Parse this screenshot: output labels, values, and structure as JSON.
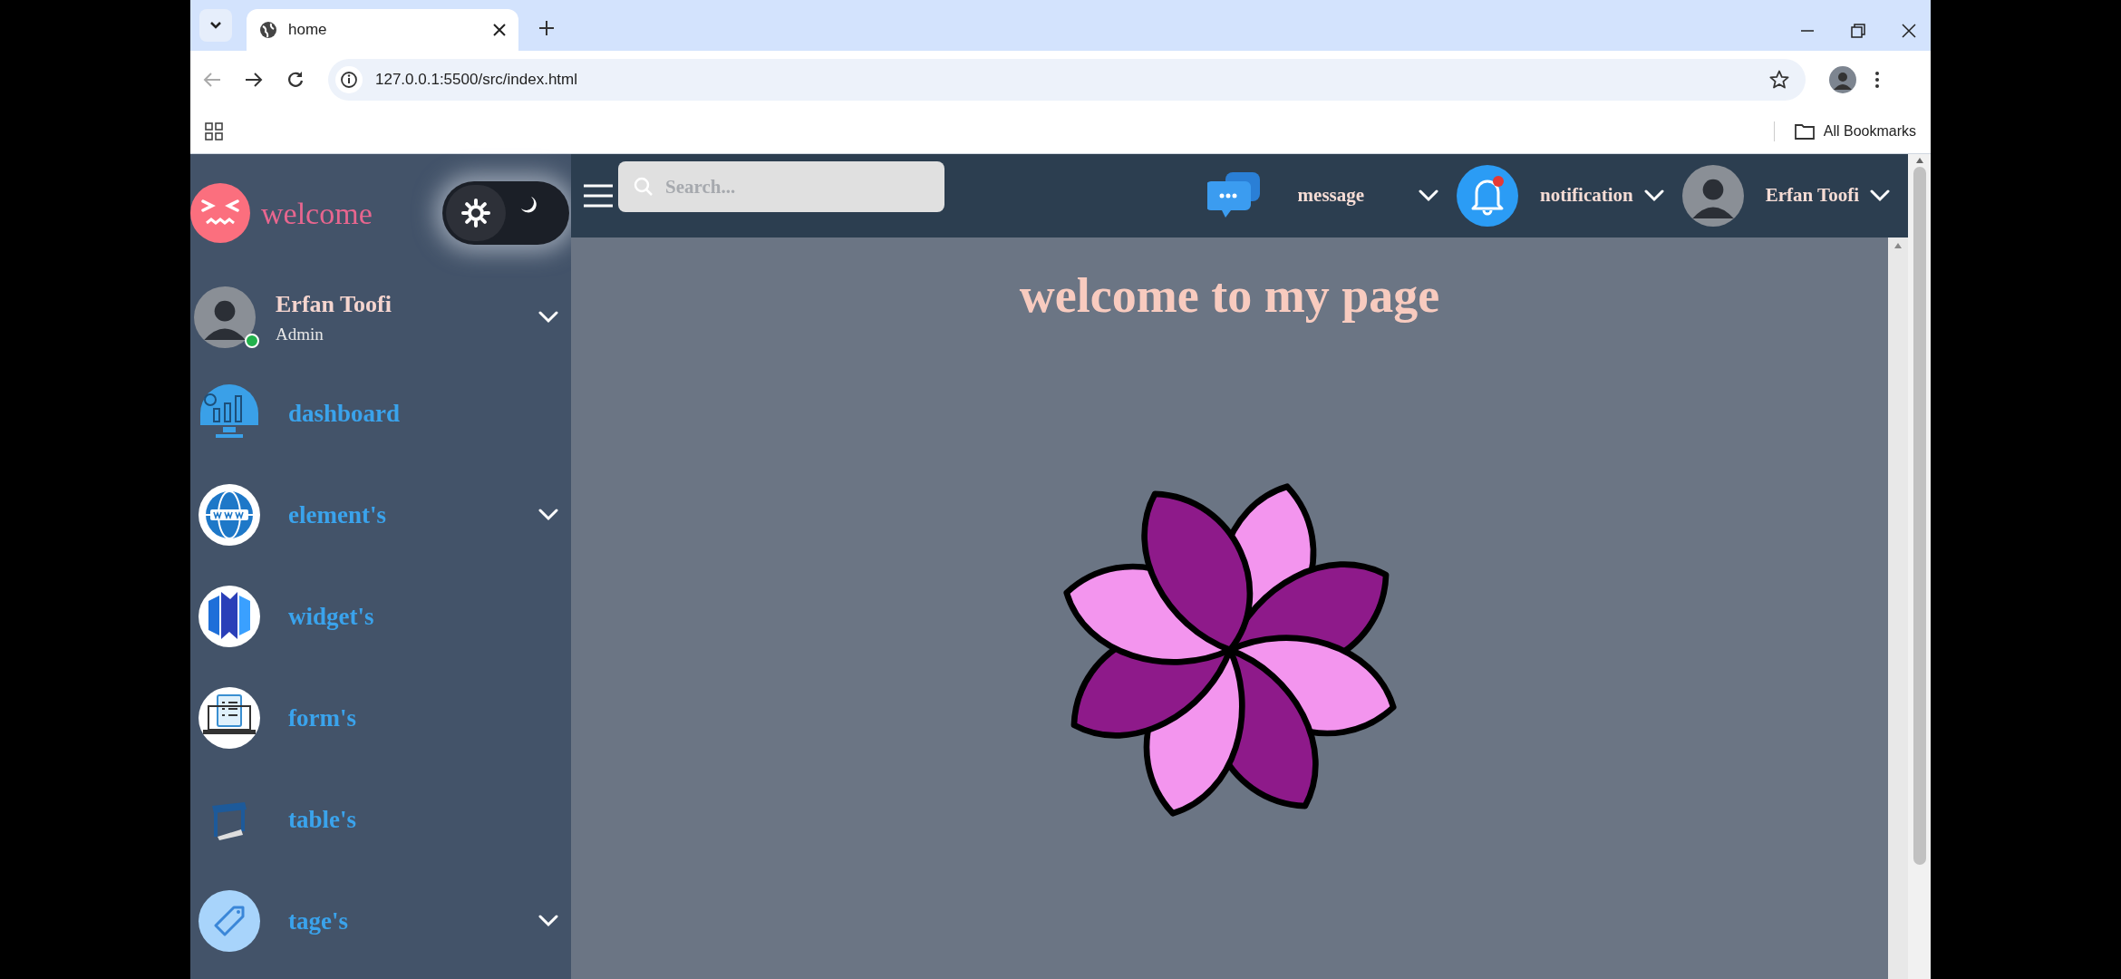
{
  "browser": {
    "tab": {
      "title": "home"
    },
    "address": "127.0.0.1:5500/src/index.html",
    "bookmarks": "All Bookmarks"
  },
  "sidebar": {
    "brand": "welcome",
    "theme_toggle": {
      "dark": true
    },
    "user": {
      "name": "Erfan Toofi",
      "role": "Admin",
      "online": true
    },
    "items": [
      {
        "label": "dashboard",
        "kind": "dashboard",
        "expandable": false
      },
      {
        "label": "element's",
        "kind": "globe",
        "expandable": true
      },
      {
        "label": "widget's",
        "kind": "widget",
        "expandable": false
      },
      {
        "label": "form's",
        "kind": "form",
        "expandable": false
      },
      {
        "label": "table's",
        "kind": "table",
        "expandable": false
      },
      {
        "label": "tage's",
        "kind": "tag",
        "expandable": true
      }
    ]
  },
  "header": {
    "search": {
      "placeholder": "Search..."
    },
    "menus": [
      {
        "label": "message",
        "kind": "message"
      },
      {
        "label": "notification",
        "kind": "notification"
      },
      {
        "label": "Erfan Toofi",
        "kind": "user"
      }
    ]
  },
  "main": {
    "title": "welcome to my page"
  }
}
